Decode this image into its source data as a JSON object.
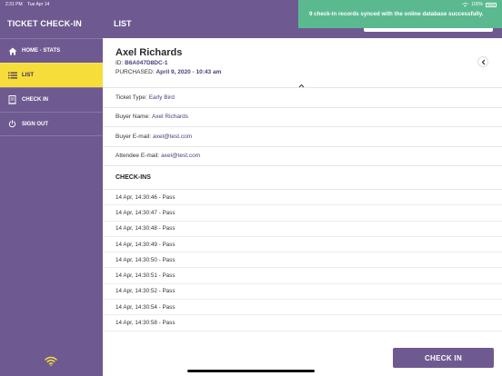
{
  "status_bar": {
    "time": "2:31 PM",
    "date": "Tue Apr 14",
    "battery": "100%"
  },
  "sidebar": {
    "title": "TICKET CHECK-IN",
    "items": [
      {
        "label": "HOME - STATS",
        "icon": "home-icon",
        "active": false
      },
      {
        "label": "LIST",
        "icon": "list-icon",
        "active": true
      },
      {
        "label": "CHECK IN",
        "icon": "ticket-icon",
        "active": false
      },
      {
        "label": "SIGN OUT",
        "icon": "power-icon",
        "active": false
      }
    ],
    "footer_icon": "wifi-icon"
  },
  "header": {
    "title": "LIST"
  },
  "toast": {
    "message": "9 check-in records synced with the online database successfully."
  },
  "ticket": {
    "name": "Axel Richards",
    "id_label": "ID:",
    "id_value": "B6A047D8DC-1",
    "purchased_label": "PURCHASED:",
    "purchased_value": "April 9, 2020 - 10:43 am"
  },
  "details": [
    {
      "label": "Ticket Type:",
      "value": "Early Bird"
    },
    {
      "label": "Buyer Name:",
      "value": "Axel Richards"
    },
    {
      "label": "Buyer E-mail:",
      "value": "axel@test.com"
    },
    {
      "label": "Attendee E-mail:",
      "value": "axel@test.com"
    }
  ],
  "checkins": {
    "title": "CHECK-INS",
    "rows": [
      "14 Apr, 14:30:46 - Pass",
      "14 Apr, 14:30:47 - Pass",
      "14 Apr, 14:30:48 - Pass",
      "14 Apr, 14:30:49 - Pass",
      "14 Apr, 14:30:50 - Pass",
      "14 Apr, 14:30:51 - Pass",
      "14 Apr, 14:30:52 - Pass",
      "14 Apr, 14:30:54 - Pass",
      "14 Apr, 14:30:58 - Pass"
    ]
  },
  "actions": {
    "check_in": "CHECK IN"
  },
  "colors": {
    "primary": "#6e5a90",
    "active_nav": "#f7dd3a",
    "toast": "#5bb990",
    "link": "#4a3c7a"
  }
}
